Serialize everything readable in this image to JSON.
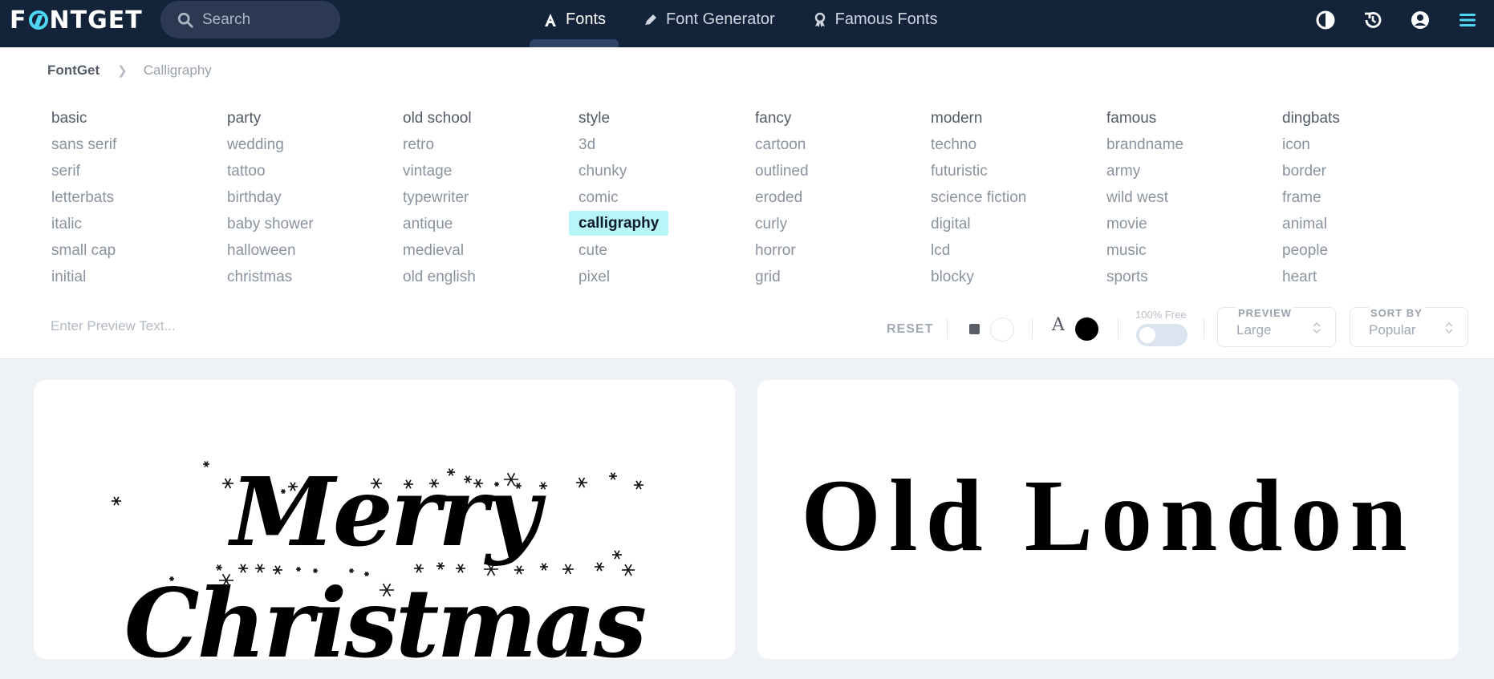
{
  "brand": {
    "name_left": "F",
    "name_right": "NTGET"
  },
  "search": {
    "placeholder": "Search"
  },
  "nav": [
    {
      "label": "Fonts",
      "icon": "font-a-icon",
      "active": true
    },
    {
      "label": "Font Generator",
      "icon": "pen-icon",
      "active": false
    },
    {
      "label": "Famous Fonts",
      "icon": "ribbon-icon",
      "active": false
    }
  ],
  "tools": [
    "contrast-icon",
    "history-icon",
    "user-icon",
    "menu-icon"
  ],
  "breadcrumb": {
    "home": "FontGet",
    "current": "Calligraphy"
  },
  "categories": [
    {
      "head": "basic",
      "items": [
        "sans serif",
        "serif",
        "letterbats",
        "italic",
        "small cap",
        "initial"
      ]
    },
    {
      "head": "party",
      "items": [
        "wedding",
        "tattoo",
        "birthday",
        "baby shower",
        "halloween",
        "christmas"
      ]
    },
    {
      "head": "old school",
      "items": [
        "retro",
        "vintage",
        "typewriter",
        "antique",
        "medieval",
        "old english"
      ]
    },
    {
      "head": "style",
      "items": [
        "3d",
        "chunky",
        "comic",
        "calligraphy",
        "cute",
        "pixel"
      ]
    },
    {
      "head": "fancy",
      "items": [
        "cartoon",
        "outlined",
        "eroded",
        "curly",
        "horror",
        "grid"
      ]
    },
    {
      "head": "modern",
      "items": [
        "techno",
        "futuristic",
        "science fiction",
        "digital",
        "lcd",
        "blocky"
      ]
    },
    {
      "head": "famous",
      "items": [
        "brandname",
        "army",
        "wild west",
        "movie",
        "music",
        "sports"
      ]
    },
    {
      "head": "dingbats",
      "items": [
        "icon",
        "border",
        "frame",
        "animal",
        "people",
        "heart"
      ]
    }
  ],
  "selected_category": "calligraphy",
  "preview": {
    "text_placeholder": "Enter Preview Text...",
    "reset_label": "RESET",
    "free_label": "100% Free",
    "size_label": "PREVIEW",
    "size_value": "Large",
    "sort_label": "SORT BY",
    "sort_value": "Popular",
    "bg_color": "#ffffff",
    "text_color": "#000000"
  },
  "cards": [
    {
      "sample": "Merry Christmas"
    },
    {
      "sample": "Old London"
    }
  ],
  "colors": {
    "nav_bg": "#13233a",
    "accent": "#4fd6f2",
    "highlight": "#b7f5f9",
    "page_bg": "#eef1f6"
  }
}
